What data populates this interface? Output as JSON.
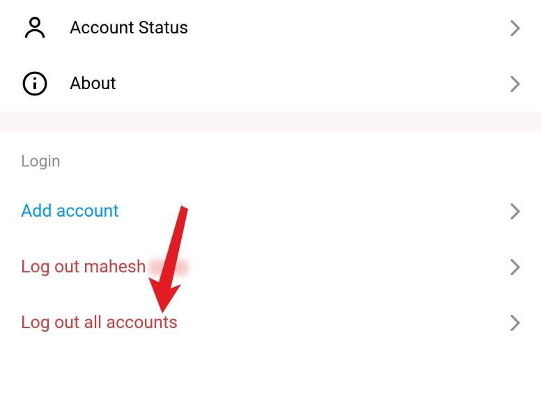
{
  "settings": {
    "items": [
      {
        "icon": "person",
        "label": "Account Status"
      },
      {
        "icon": "info",
        "label": "About"
      }
    ]
  },
  "login_section": {
    "header": "Login",
    "items": [
      {
        "label": "Add account",
        "style": "blue"
      },
      {
        "label": "Log out mahesh",
        "style": "red",
        "has_blur": true
      },
      {
        "label": "Log out all accounts",
        "style": "red"
      }
    ]
  }
}
